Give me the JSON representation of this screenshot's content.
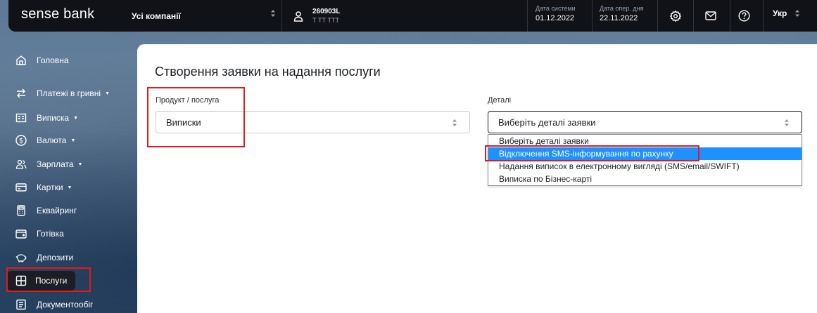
{
  "header": {
    "logo": "sense bank",
    "company": "Усі компанії",
    "user_account": "260903L",
    "user_name": "Т ТТ ТТТ",
    "system_date_label": "Дата системи",
    "system_date": "01.12.2022",
    "oper_day_label": "Дата опер. дня",
    "oper_day": "22.11.2022",
    "language": "Укр"
  },
  "sidebar": {
    "items": [
      {
        "label": "Головна",
        "icon": "home-icon",
        "has_caret": false
      },
      {
        "label": "Платежі в гривні",
        "icon": "transfer-arrows-icon",
        "has_caret": true
      },
      {
        "label": "Виписка",
        "icon": "statement-icon",
        "has_caret": true
      },
      {
        "label": "Валюта",
        "icon": "dollar-icon",
        "has_caret": true
      },
      {
        "label": "Зарплата",
        "icon": "people-icon",
        "has_caret": true
      },
      {
        "label": "Картки",
        "icon": "card-icon",
        "has_caret": true
      },
      {
        "label": "Еквайринг",
        "icon": "terminal-icon",
        "has_caret": false
      },
      {
        "label": "Готівка",
        "icon": "wallet-icon",
        "has_caret": false
      },
      {
        "label": "Депозити",
        "icon": "piggy-bank-icon",
        "has_caret": false
      },
      {
        "label": "Послуги",
        "icon": "grid-icon",
        "has_caret": false
      },
      {
        "label": "Документообіг",
        "icon": "document-icon",
        "has_caret": false
      }
    ],
    "active": "Послуги"
  },
  "main": {
    "title": "Створення заявки на надання послуги",
    "product_label": "Продукт / послуга",
    "product_value": "Виписки",
    "details_label": "Деталі",
    "details_value": "Виберіть деталі заявки",
    "details_options": [
      "Виберіть деталі заявки",
      "Відключення SMS-інформування по рахунку",
      "Надання виписок в електронному вигляді (SMS/email/SWIFT)",
      "Виписка по Бізнес-карті"
    ],
    "highlighted_option": "Відключення SMS-інформування по рахунку"
  },
  "colors": {
    "header_bg": "#111217",
    "highlight": "#1e90ff",
    "annotation": "#e01b1b"
  }
}
